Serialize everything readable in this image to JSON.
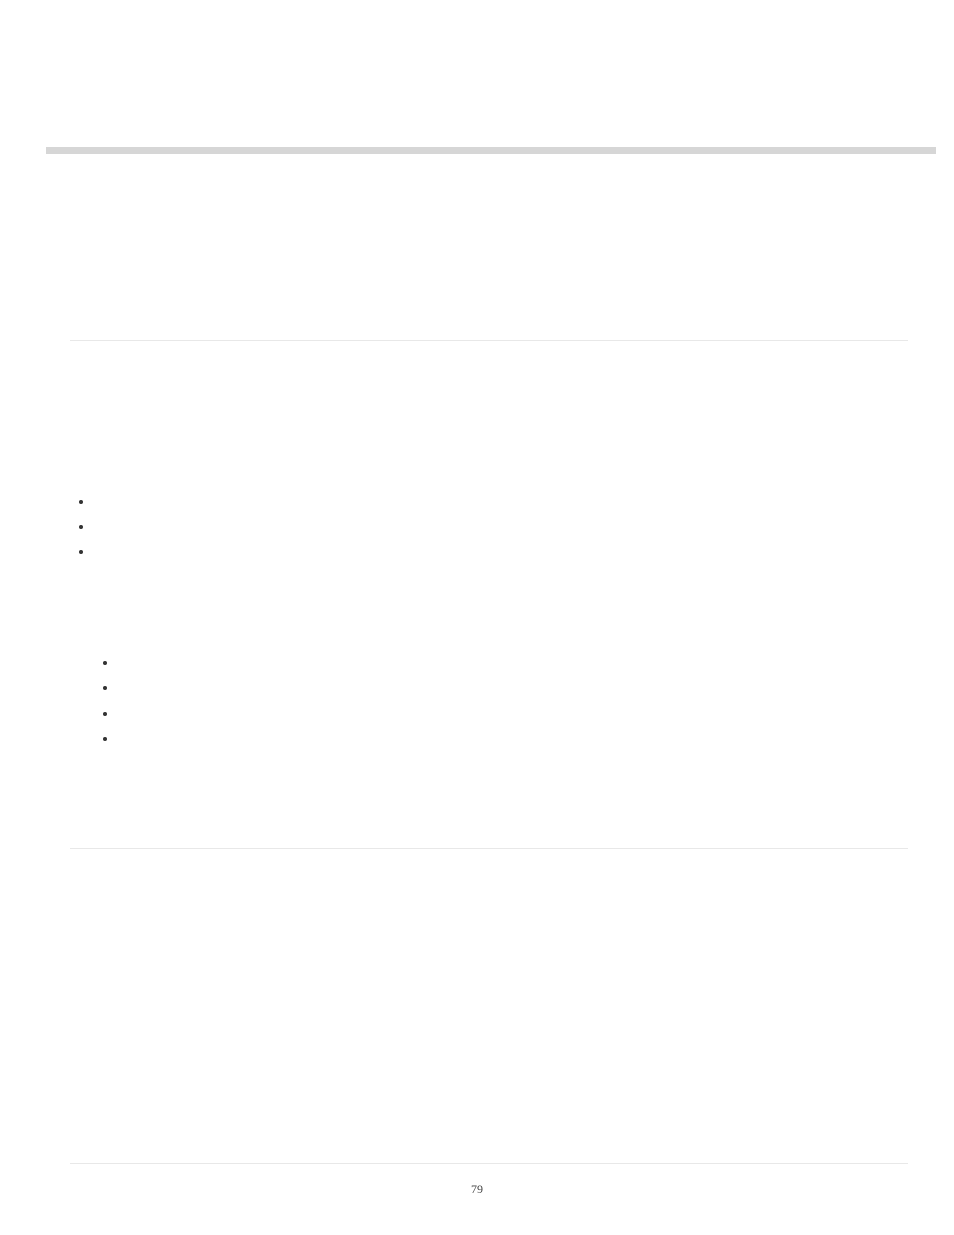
{
  "page_number": "79"
}
